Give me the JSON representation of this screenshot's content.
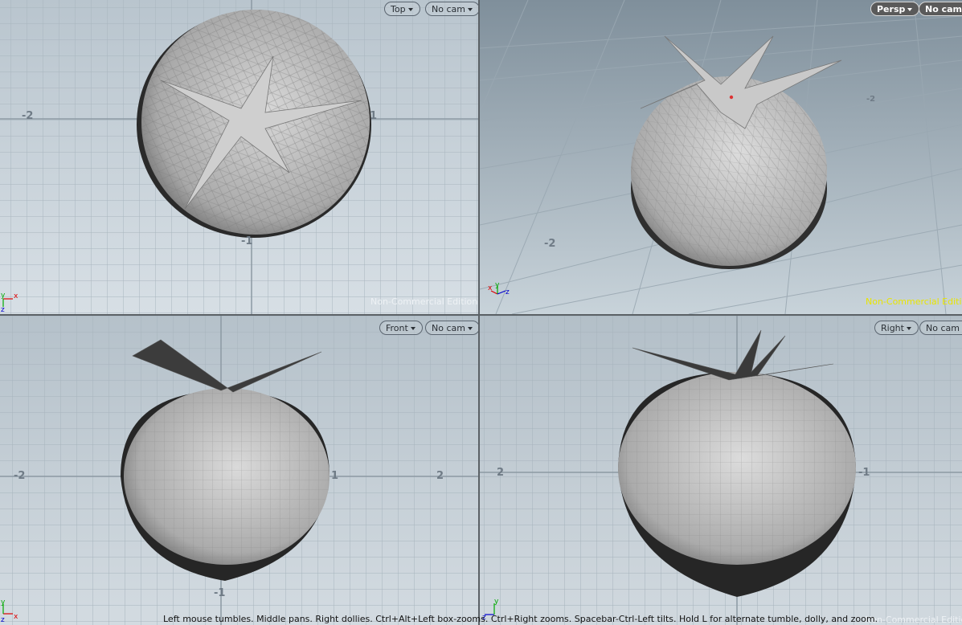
{
  "viewports": {
    "top": {
      "view_label": "Top",
      "camera_label": "No cam",
      "edition": "Non-Commercial Edition",
      "ticks": [
        "-2",
        "1",
        "-1"
      ],
      "axes": [
        "y",
        "x",
        "z"
      ]
    },
    "persp": {
      "view_label": "Persp",
      "camera_label": "No cam",
      "edition": "Non-Commercial Edition",
      "ticks": [
        "-2",
        "-2"
      ],
      "axes": [
        "x",
        "y",
        "z"
      ]
    },
    "front": {
      "view_label": "Front",
      "camera_label": "No cam",
      "edition": "",
      "ticks": [
        "-2",
        "1",
        "2",
        "-1"
      ],
      "axes": [
        "y",
        "z",
        "x"
      ]
    },
    "right": {
      "view_label": "Right",
      "camera_label": "No cam",
      "edition": "Non-Commercial Edition",
      "ticks": [
        "2",
        "-1"
      ],
      "axes": [
        "y",
        "z"
      ]
    }
  },
  "status_bar": "Left mouse tumbles. Middle pans. Right dollies. Ctrl+Alt+Left box-zooms. Ctrl+Right zooms. Spacebar-Ctrl-Left tilts. Hold L for alternate tumble, dolly, and zoom.",
  "colors": {
    "viewport_bg_top": "#cbd5dc",
    "viewport_bg_bottom": "#8c9ba6",
    "grid": "#a7b5bf",
    "mesh": "#a9a9a9"
  },
  "icons": [
    "dropdown-caret-icon",
    "axis-gizmo-icon"
  ]
}
